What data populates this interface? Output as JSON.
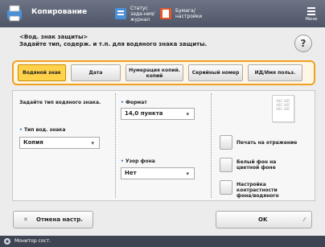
{
  "header": {
    "title": "Копирование",
    "btn_status_label": "Статус зада-ния/журнал",
    "btn_paper_label": "Бумага/ настройки",
    "menu_label": "Меню"
  },
  "instruction": {
    "line1": "<Вод. знак защиты>",
    "line2": "Задайте тип, содерж. и т.п. для водяного знака защиты."
  },
  "help_label": "?",
  "tabs": [
    {
      "label": "Водяной знак",
      "selected": true
    },
    {
      "label": "Дата",
      "selected": false
    },
    {
      "label": "Нумерация копий. копий",
      "selected": false
    },
    {
      "label": "Серийный номер",
      "selected": false
    },
    {
      "label": "ИД/Имя польз.",
      "selected": false
    }
  ],
  "panel": {
    "heading": "Задайте тип водяного знака.",
    "type_label": "Тип вод. знака",
    "type_value": "Копия",
    "format_label": "Формат",
    "format_value": "14,0 пункта",
    "bg_label": "Узор фона",
    "bg_value": "Нет",
    "preview_text": "ABC ABC ABC ABC ABC ABC",
    "side_buttons": [
      "Печать на отражение",
      "Белый фон на цветной фоне",
      "Настройка контрастности фона/водяного"
    ]
  },
  "footer": {
    "cancel_label": "Отмена настр.",
    "ok_label": "OK"
  },
  "statusbar": {
    "text": "Монитор сост."
  },
  "colors": {
    "accent": "#f0a020",
    "selected_tab": "#ffd24a",
    "header": "#5a6173"
  }
}
